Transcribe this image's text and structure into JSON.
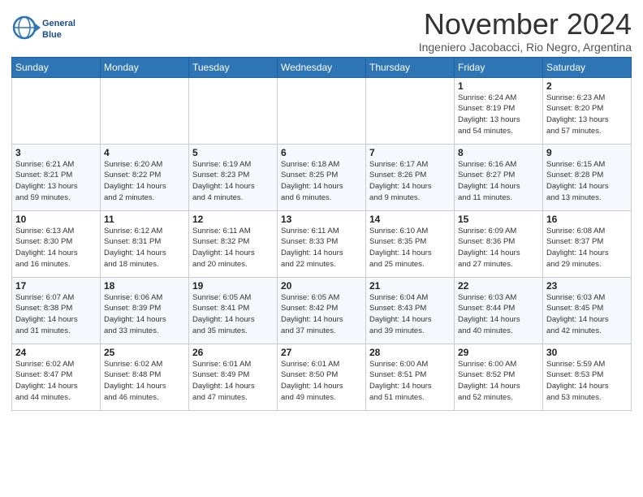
{
  "header": {
    "logo_line1": "General",
    "logo_line2": "Blue",
    "month": "November 2024",
    "location": "Ingeniero Jacobacci, Rio Negro, Argentina"
  },
  "weekdays": [
    "Sunday",
    "Monday",
    "Tuesday",
    "Wednesday",
    "Thursday",
    "Friday",
    "Saturday"
  ],
  "weeks": [
    [
      {
        "day": "",
        "info": ""
      },
      {
        "day": "",
        "info": ""
      },
      {
        "day": "",
        "info": ""
      },
      {
        "day": "",
        "info": ""
      },
      {
        "day": "",
        "info": ""
      },
      {
        "day": "1",
        "info": "Sunrise: 6:24 AM\nSunset: 8:19 PM\nDaylight: 13 hours\nand 54 minutes."
      },
      {
        "day": "2",
        "info": "Sunrise: 6:23 AM\nSunset: 8:20 PM\nDaylight: 13 hours\nand 57 minutes."
      }
    ],
    [
      {
        "day": "3",
        "info": "Sunrise: 6:21 AM\nSunset: 8:21 PM\nDaylight: 13 hours\nand 59 minutes."
      },
      {
        "day": "4",
        "info": "Sunrise: 6:20 AM\nSunset: 8:22 PM\nDaylight: 14 hours\nand 2 minutes."
      },
      {
        "day": "5",
        "info": "Sunrise: 6:19 AM\nSunset: 8:23 PM\nDaylight: 14 hours\nand 4 minutes."
      },
      {
        "day": "6",
        "info": "Sunrise: 6:18 AM\nSunset: 8:25 PM\nDaylight: 14 hours\nand 6 minutes."
      },
      {
        "day": "7",
        "info": "Sunrise: 6:17 AM\nSunset: 8:26 PM\nDaylight: 14 hours\nand 9 minutes."
      },
      {
        "day": "8",
        "info": "Sunrise: 6:16 AM\nSunset: 8:27 PM\nDaylight: 14 hours\nand 11 minutes."
      },
      {
        "day": "9",
        "info": "Sunrise: 6:15 AM\nSunset: 8:28 PM\nDaylight: 14 hours\nand 13 minutes."
      }
    ],
    [
      {
        "day": "10",
        "info": "Sunrise: 6:13 AM\nSunset: 8:30 PM\nDaylight: 14 hours\nand 16 minutes."
      },
      {
        "day": "11",
        "info": "Sunrise: 6:12 AM\nSunset: 8:31 PM\nDaylight: 14 hours\nand 18 minutes."
      },
      {
        "day": "12",
        "info": "Sunrise: 6:11 AM\nSunset: 8:32 PM\nDaylight: 14 hours\nand 20 minutes."
      },
      {
        "day": "13",
        "info": "Sunrise: 6:11 AM\nSunset: 8:33 PM\nDaylight: 14 hours\nand 22 minutes."
      },
      {
        "day": "14",
        "info": "Sunrise: 6:10 AM\nSunset: 8:35 PM\nDaylight: 14 hours\nand 25 minutes."
      },
      {
        "day": "15",
        "info": "Sunrise: 6:09 AM\nSunset: 8:36 PM\nDaylight: 14 hours\nand 27 minutes."
      },
      {
        "day": "16",
        "info": "Sunrise: 6:08 AM\nSunset: 8:37 PM\nDaylight: 14 hours\nand 29 minutes."
      }
    ],
    [
      {
        "day": "17",
        "info": "Sunrise: 6:07 AM\nSunset: 8:38 PM\nDaylight: 14 hours\nand 31 minutes."
      },
      {
        "day": "18",
        "info": "Sunrise: 6:06 AM\nSunset: 8:39 PM\nDaylight: 14 hours\nand 33 minutes."
      },
      {
        "day": "19",
        "info": "Sunrise: 6:05 AM\nSunset: 8:41 PM\nDaylight: 14 hours\nand 35 minutes."
      },
      {
        "day": "20",
        "info": "Sunrise: 6:05 AM\nSunset: 8:42 PM\nDaylight: 14 hours\nand 37 minutes."
      },
      {
        "day": "21",
        "info": "Sunrise: 6:04 AM\nSunset: 8:43 PM\nDaylight: 14 hours\nand 39 minutes."
      },
      {
        "day": "22",
        "info": "Sunrise: 6:03 AM\nSunset: 8:44 PM\nDaylight: 14 hours\nand 40 minutes."
      },
      {
        "day": "23",
        "info": "Sunrise: 6:03 AM\nSunset: 8:45 PM\nDaylight: 14 hours\nand 42 minutes."
      }
    ],
    [
      {
        "day": "24",
        "info": "Sunrise: 6:02 AM\nSunset: 8:47 PM\nDaylight: 14 hours\nand 44 minutes."
      },
      {
        "day": "25",
        "info": "Sunrise: 6:02 AM\nSunset: 8:48 PM\nDaylight: 14 hours\nand 46 minutes."
      },
      {
        "day": "26",
        "info": "Sunrise: 6:01 AM\nSunset: 8:49 PM\nDaylight: 14 hours\nand 47 minutes."
      },
      {
        "day": "27",
        "info": "Sunrise: 6:01 AM\nSunset: 8:50 PM\nDaylight: 14 hours\nand 49 minutes."
      },
      {
        "day": "28",
        "info": "Sunrise: 6:00 AM\nSunset: 8:51 PM\nDaylight: 14 hours\nand 51 minutes."
      },
      {
        "day": "29",
        "info": "Sunrise: 6:00 AM\nSunset: 8:52 PM\nDaylight: 14 hours\nand 52 minutes."
      },
      {
        "day": "30",
        "info": "Sunrise: 5:59 AM\nSunset: 8:53 PM\nDaylight: 14 hours\nand 53 minutes."
      }
    ]
  ]
}
